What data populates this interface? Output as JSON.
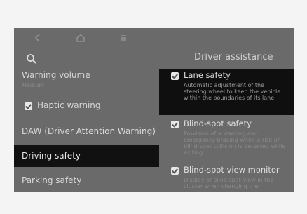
{
  "topbar": {
    "back_icon": "chevron-left-icon",
    "home_icon": "home-icon",
    "menu_icon": "menu-icon"
  },
  "left": {
    "search_icon": "search-icon",
    "warning_volume": {
      "label": "Warning volume",
      "value": "Medium"
    },
    "haptic_warning": {
      "label": "Haptic warning",
      "checked": true
    },
    "items": [
      {
        "label": "DAW (Driver Attention Warning)"
      },
      {
        "label": "Driving safety",
        "active": true
      },
      {
        "label": "Parking safety"
      }
    ]
  },
  "right": {
    "title": "Driver assistance",
    "options": [
      {
        "title": "Lane safety",
        "checked": true,
        "active": true,
        "desc": "Automatic adjustment of the steering wheel to keep the vehicle within the boundaries of its lane."
      },
      {
        "title": "Blind-spot safety",
        "checked": true,
        "desc": "Provision of a warning and emergency braking when a risk of blind-spot collision is detected while exiting."
      },
      {
        "title": "Blind-spot view monitor",
        "checked": true,
        "desc": "Display of blind spot view in the cluster when changing the"
      }
    ]
  },
  "colors": {
    "background": "#6a6a6a",
    "highlight": "#111111"
  }
}
